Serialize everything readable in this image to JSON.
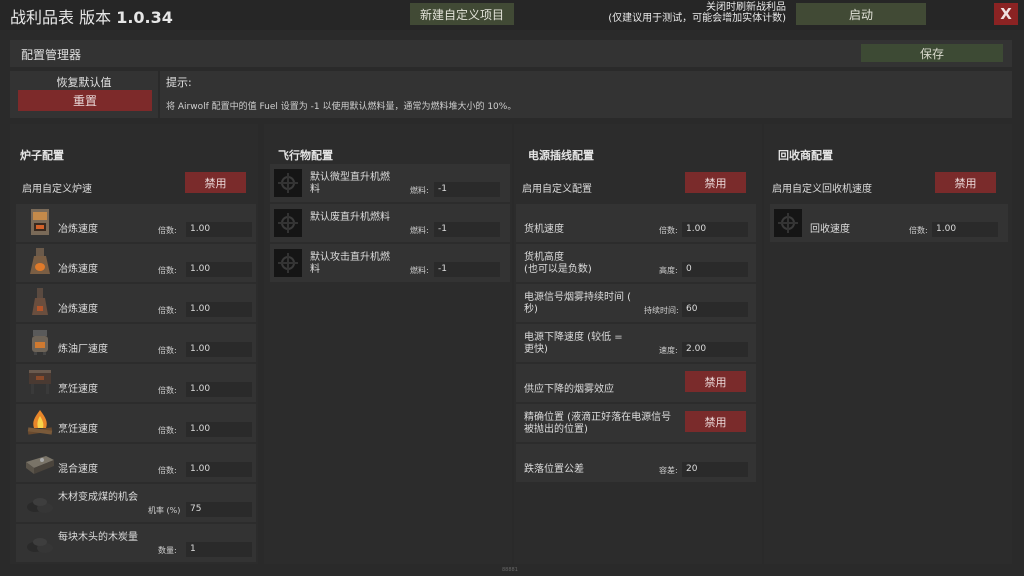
{
  "header": {
    "title": "战利品表 版本",
    "version": "1.0.34",
    "new_custom_label": "新建自定义项目",
    "refresh_hint_line1": "关闭时刷新战利品",
    "refresh_hint_line2": "(仅建议用于测试，可能会增加实体计数)",
    "start_label": "启动",
    "close_label": "X"
  },
  "manager": {
    "title": "配置管理器",
    "save_label": "保存",
    "restore_title": "恢复默认值",
    "reset_label": "重置",
    "hint_label": "提示:",
    "hint_text": "将 Airwolf 配置中的值 Fuel 设置为 -1 以使用默认燃料量，通常为燃料堆大小的 10%。"
  },
  "furnace": {
    "title": "炉子配置",
    "enable_label": "启用自定义炉速",
    "disable_label": "禁用",
    "rows": [
      {
        "icon": "furnace-icon",
        "label": "冶炼速度",
        "field": "倍数:",
        "value": "1.00"
      },
      {
        "icon": "large-furnace-icon",
        "label": "冶炼速度",
        "field": "倍数:",
        "value": "1.00"
      },
      {
        "icon": "electric-furnace-icon",
        "label": "冶炼速度",
        "field": "倍数:",
        "value": "1.00"
      },
      {
        "icon": "oil-refinery-icon",
        "label": "炼油厂速度",
        "field": "倍数:",
        "value": "1.00"
      },
      {
        "icon": "bbq-icon",
        "label": "烹饪速度",
        "field": "倍数:",
        "value": "1.00"
      },
      {
        "icon": "campfire-icon",
        "label": "烹饪速度",
        "field": "倍数:",
        "value": "1.00"
      },
      {
        "icon": "mixing-table-icon",
        "label": "混合速度",
        "field": "倍数:",
        "value": "1.00"
      },
      {
        "icon": "charcoal-icon",
        "label": "木材变成煤的机会",
        "field": "机率 (%)",
        "value": "75"
      },
      {
        "icon": "charcoal-icon",
        "label": "每块木头的木炭量",
        "field": "数量:",
        "value": "1"
      }
    ]
  },
  "aircraft": {
    "title": "飞行物配置",
    "rows": [
      {
        "icon": "rust-logo-icon",
        "label": "默认微型直升机燃料",
        "field": "燃料:",
        "value": "-1"
      },
      {
        "icon": "rust-logo-icon",
        "label": "默认废直升机燃料",
        "field": "燃料:",
        "value": "-1"
      },
      {
        "icon": "rust-logo-icon",
        "label": "默认攻击直升机燃料",
        "field": "燃料:",
        "value": "-1"
      }
    ]
  },
  "supply": {
    "title": "电源插线配置",
    "enable_label": "启用自定义配置",
    "disable_label": "禁用",
    "rows": [
      {
        "label": "货机速度",
        "field": "倍数:",
        "value": "1.00"
      },
      {
        "label": "货机高度\n(也可以是负数)",
        "field": "高度:",
        "value": "0"
      },
      {
        "label": "电源信号烟雾持续时间 (\n秒)",
        "field": "持续时间:",
        "value": "60"
      },
      {
        "label": "电源下降速度 (较低 =\n更快)",
        "field": "速度:",
        "value": "2.00"
      }
    ],
    "smoke_label": "供应下降的烟雾效应",
    "smoke_button": "禁用",
    "precise_label": "精确位置 (液滴正好落在电源信号\n被抛出的位置)",
    "precise_button": "禁用",
    "tolerance_label": "跌落位置公差",
    "tolerance_field": "容差:",
    "tolerance_value": "20"
  },
  "recycler": {
    "title": "回收商配置",
    "enable_label": "启用自定义回收机速度",
    "disable_label": "禁用",
    "rows": [
      {
        "icon": "rust-logo-icon",
        "label": "回收速度",
        "field": "倍数:",
        "value": "1.00"
      }
    ]
  },
  "footer_mark": "88881"
}
